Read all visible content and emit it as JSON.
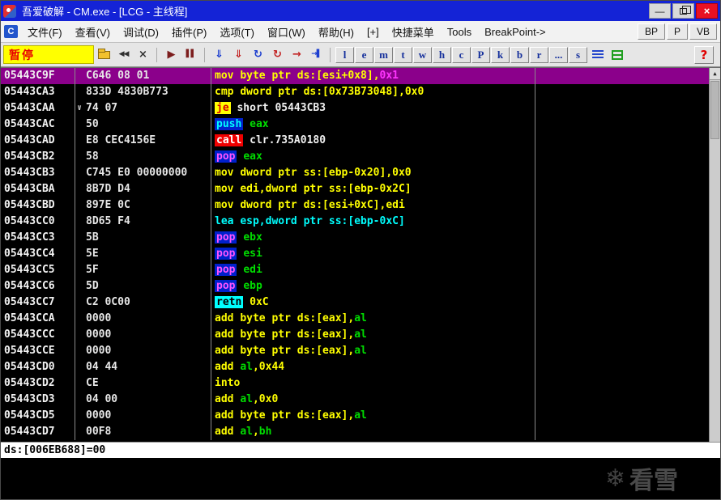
{
  "colors": {
    "titlebar": "#1423d6",
    "selection": "#8b008b",
    "pause_bg": "#ffff00",
    "pause_fg": "#e80000"
  },
  "icons": {
    "mdi_child": "C",
    "minimize": "—",
    "close": "×",
    "up_arrow": "▲",
    "snowflake": "❄"
  },
  "window": {
    "title": "吾爱破解 - CM.exe - [LCG -  主线程]"
  },
  "menubar": {
    "items": [
      {
        "id": "file",
        "label": "文件(F)"
      },
      {
        "id": "view",
        "label": "查看(V)"
      },
      {
        "id": "debug",
        "label": "调试(D)"
      },
      {
        "id": "plugins",
        "label": "插件(P)"
      },
      {
        "id": "options",
        "label": "选项(T)"
      },
      {
        "id": "window",
        "label": "窗口(W)"
      },
      {
        "id": "help",
        "label": "帮助(H)"
      },
      {
        "id": "plus",
        "label": "[+]"
      },
      {
        "id": "quick-menu",
        "label": "快捷菜单"
      },
      {
        "id": "tools",
        "label": "Tools"
      },
      {
        "id": "breakpoint",
        "label": "BreakPoint->"
      }
    ],
    "right_buttons": [
      {
        "id": "bp",
        "label": "BP"
      },
      {
        "id": "p",
        "label": "P"
      },
      {
        "id": "vb",
        "label": "VB"
      }
    ]
  },
  "toolbar": {
    "pause_label": "暂停",
    "help_label": "?",
    "icon_buttons": [
      {
        "name": "open-file-button",
        "icon": "folder-icon",
        "type": "folder"
      },
      {
        "name": "restart-button",
        "icon": "rewind-icon",
        "glyph": "◀◀",
        "color": "#303030"
      },
      {
        "name": "close-program-button",
        "icon": "close-x-icon",
        "glyph": "×",
        "color": "#303030"
      },
      {
        "type": "sep"
      },
      {
        "name": "run-button",
        "icon": "play-icon",
        "glyph": "▶",
        "color": "#7c1d1d"
      },
      {
        "name": "pause-exec-button",
        "icon": "pause-icon",
        "glyph": "▌▌",
        "color": "#7c1d1d"
      },
      {
        "type": "sep"
      },
      {
        "name": "step-into-button",
        "icon": "step-into-icon",
        "glyph": "⇓",
        "color": "#1c3ecf"
      },
      {
        "name": "step-over-button",
        "icon": "step-over-icon",
        "glyph": "⇓",
        "color": "#c22222"
      },
      {
        "name": "animate-into-button",
        "icon": "animate-into-icon",
        "glyph": "↻",
        "color": "#1c3ecf"
      },
      {
        "name": "animate-over-button",
        "icon": "animate-over-icon",
        "glyph": "↻",
        "color": "#c22222"
      },
      {
        "name": "execute-till-return-button",
        "icon": "till-return-icon",
        "glyph": "→",
        "color": "#c22222"
      },
      {
        "name": "run-to-cursor-button",
        "icon": "run-to-cursor-icon",
        "glyph": "→▌",
        "color": "#1c3ecf"
      },
      {
        "type": "sep"
      }
    ],
    "letter_buttons": [
      "l",
      "e",
      "m",
      "t",
      "w",
      "h",
      "c",
      "P",
      "k",
      "b",
      "r",
      "...",
      "s"
    ],
    "tail_buttons": [
      {
        "name": "log-list-button",
        "icon": "list-icon",
        "type": "list"
      },
      {
        "name": "patches-window-button",
        "icon": "green-grid-icon",
        "type": "greengrid"
      }
    ]
  },
  "disassembly": {
    "selection_color": "#8b008b",
    "jump_marker_glyph": "∨",
    "rows": [
      {
        "address": "05443C9F",
        "bytes": "C646 08 01",
        "selected": true,
        "tokens": [
          {
            "t": "mov ",
            "c": "#ffff00"
          },
          {
            "t": "byte ptr ds:[esi+0x8]",
            "c": "#ffff00"
          },
          {
            "t": ",",
            "c": "#ffff00"
          },
          {
            "t": "0x1",
            "c": "#ff35ff"
          }
        ]
      },
      {
        "address": "05443CA3",
        "bytes": "833D 4830B773",
        "tokens": [
          {
            "t": "cmp ",
            "c": "#ffff00"
          },
          {
            "t": "dword ptr ds:[0x73B73048]",
            "c": "#ffff00"
          },
          {
            "t": ",",
            "c": "#ffff00"
          },
          {
            "t": "0x0",
            "c": "#ffff00"
          }
        ]
      },
      {
        "address": "05443CAA",
        "bytes": "74 07",
        "jump_down": true,
        "tokens": [
          {
            "t": "je",
            "c": "#d40000",
            "bg": "#ffff00"
          },
          {
            "t": " "
          },
          {
            "t": "short 05443CB3",
            "c": "#f0f0f0"
          }
        ]
      },
      {
        "address": "05443CAC",
        "bytes": "50",
        "tokens": [
          {
            "t": "push",
            "c": "#00ffff",
            "bg": "#0021cc"
          },
          {
            "t": " "
          },
          {
            "t": "eax",
            "c": "#00dd00"
          }
        ]
      },
      {
        "address": "05443CAD",
        "bytes": "E8 CEC4156E",
        "tokens": [
          {
            "t": "call",
            "c": "#ffffff",
            "bg": "#f00000"
          },
          {
            "t": " "
          },
          {
            "t": "clr.735A0180",
            "c": "#f0f0f0"
          }
        ]
      },
      {
        "address": "05443CB2",
        "bytes": "58",
        "tokens": [
          {
            "t": "pop",
            "c": "#ff55ff",
            "bg": "#0021cc"
          },
          {
            "t": " "
          },
          {
            "t": "eax",
            "c": "#00dd00"
          }
        ]
      },
      {
        "address": "05443CB3",
        "bytes": "C745 E0 00000000",
        "tokens": [
          {
            "t": "mov ",
            "c": "#ffff00"
          },
          {
            "t": "dword ptr ss:[ebp-0x20]",
            "c": "#ffff00"
          },
          {
            "t": ",",
            "c": "#ffff00"
          },
          {
            "t": "0x0",
            "c": "#ffff00"
          }
        ]
      },
      {
        "address": "05443CBA",
        "bytes": "8B7D D4",
        "tokens": [
          {
            "t": "mov ",
            "c": "#ffff00"
          },
          {
            "t": "edi",
            "c": "#ffff00"
          },
          {
            "t": ",dword ptr ss:[ebp-0x2C]",
            "c": "#ffff00"
          }
        ]
      },
      {
        "address": "05443CBD",
        "bytes": "897E 0C",
        "tokens": [
          {
            "t": "mov ",
            "c": "#ffff00"
          },
          {
            "t": "dword ptr ds:[esi+0xC]",
            "c": "#ffff00"
          },
          {
            "t": ",",
            "c": "#ffff00"
          },
          {
            "t": "edi",
            "c": "#ffff00"
          }
        ]
      },
      {
        "address": "05443CC0",
        "bytes": "8D65 F4",
        "tokens": [
          {
            "t": "lea ",
            "c": "#00ffff"
          },
          {
            "t": "esp",
            "c": "#00ffff"
          },
          {
            "t": ",dword ptr ss:[ebp-0xC]",
            "c": "#00ffff"
          }
        ]
      },
      {
        "address": "05443CC3",
        "bytes": "5B",
        "tokens": [
          {
            "t": "pop",
            "c": "#ff55ff",
            "bg": "#0021cc"
          },
          {
            "t": " "
          },
          {
            "t": "ebx",
            "c": "#00dd00"
          }
        ]
      },
      {
        "address": "05443CC4",
        "bytes": "5E",
        "tokens": [
          {
            "t": "pop",
            "c": "#ff55ff",
            "bg": "#0021cc"
          },
          {
            "t": " "
          },
          {
            "t": "esi",
            "c": "#00dd00"
          }
        ]
      },
      {
        "address": "05443CC5",
        "bytes": "5F",
        "tokens": [
          {
            "t": "pop",
            "c": "#ff55ff",
            "bg": "#0021cc"
          },
          {
            "t": " "
          },
          {
            "t": "edi",
            "c": "#00dd00"
          }
        ]
      },
      {
        "address": "05443CC6",
        "bytes": "5D",
        "tokens": [
          {
            "t": "pop",
            "c": "#ff55ff",
            "bg": "#0021cc"
          },
          {
            "t": " "
          },
          {
            "t": "ebp",
            "c": "#00dd00"
          }
        ]
      },
      {
        "address": "05443CC7",
        "bytes": "C2 0C00",
        "tokens": [
          {
            "t": "retn",
            "c": "#000000",
            "bg": "#00ffff"
          },
          {
            "t": " "
          },
          {
            "t": "0xC",
            "c": "#ffff00"
          }
        ]
      },
      {
        "address": "05443CCA",
        "bytes": "0000",
        "tokens": [
          {
            "t": "add ",
            "c": "#ffff00"
          },
          {
            "t": "byte ptr ds:[eax]",
            "c": "#ffff00"
          },
          {
            "t": ",",
            "c": "#ffff00"
          },
          {
            "t": "al",
            "c": "#00dd00"
          }
        ]
      },
      {
        "address": "05443CCC",
        "bytes": "0000",
        "tokens": [
          {
            "t": "add ",
            "c": "#ffff00"
          },
          {
            "t": "byte ptr ds:[eax]",
            "c": "#ffff00"
          },
          {
            "t": ",",
            "c": "#ffff00"
          },
          {
            "t": "al",
            "c": "#00dd00"
          }
        ]
      },
      {
        "address": "05443CCE",
        "bytes": "0000",
        "tokens": [
          {
            "t": "add ",
            "c": "#ffff00"
          },
          {
            "t": "byte ptr ds:[eax]",
            "c": "#ffff00"
          },
          {
            "t": ",",
            "c": "#ffff00"
          },
          {
            "t": "al",
            "c": "#00dd00"
          }
        ]
      },
      {
        "address": "05443CD0",
        "bytes": "04 44",
        "tokens": [
          {
            "t": "add ",
            "c": "#ffff00"
          },
          {
            "t": "al",
            "c": "#00dd00"
          },
          {
            "t": ",",
            "c": "#ffff00"
          },
          {
            "t": "0x44",
            "c": "#ffff00"
          }
        ]
      },
      {
        "address": "05443CD2",
        "bytes": "CE",
        "tokens": [
          {
            "t": "into",
            "c": "#ffff00"
          }
        ]
      },
      {
        "address": "05443CD3",
        "bytes": "04 00",
        "tokens": [
          {
            "t": "add ",
            "c": "#ffff00"
          },
          {
            "t": "al",
            "c": "#00dd00"
          },
          {
            "t": ",",
            "c": "#ffff00"
          },
          {
            "t": "0x0",
            "c": "#ffff00"
          }
        ]
      },
      {
        "address": "05443CD5",
        "bytes": "0000",
        "tokens": [
          {
            "t": "add ",
            "c": "#ffff00"
          },
          {
            "t": "byte ptr ds:[eax]",
            "c": "#ffff00"
          },
          {
            "t": ",",
            "c": "#ffff00"
          },
          {
            "t": "al",
            "c": "#00dd00"
          }
        ]
      },
      {
        "address": "05443CD7",
        "bytes": "00F8",
        "tokens": [
          {
            "t": "add ",
            "c": "#ffff00"
          },
          {
            "t": "al",
            "c": "#00dd00"
          },
          {
            "t": ",",
            "c": "#ffff00"
          },
          {
            "t": "bh",
            "c": "#00dd00"
          }
        ]
      }
    ]
  },
  "statusbar": {
    "text": "ds:[006EB688]=00"
  },
  "watermark": {
    "text": "看雪"
  }
}
